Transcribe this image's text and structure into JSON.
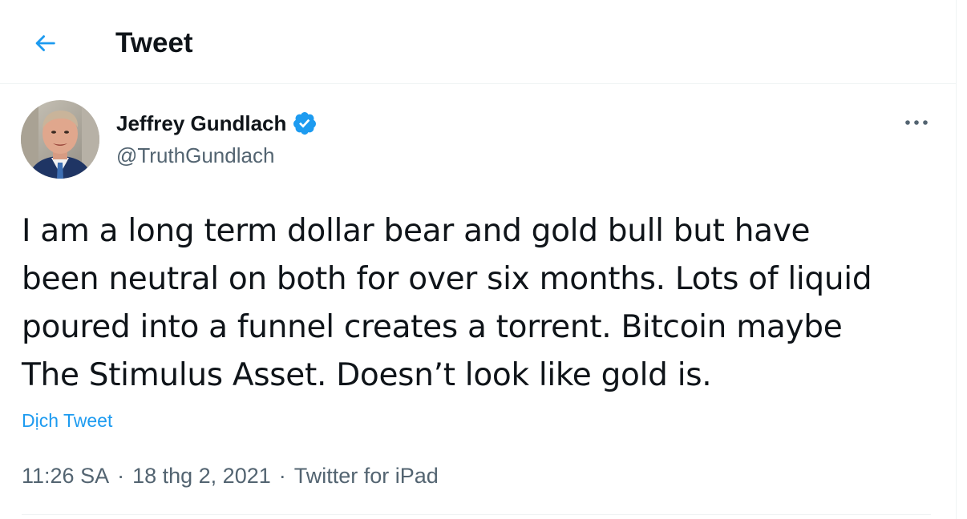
{
  "header": {
    "back_icon": "arrow-left-icon",
    "title": "Tweet"
  },
  "tweet": {
    "author": {
      "name": "Jeffrey Gundlach",
      "handle": "@TruthGundlach",
      "verified": true,
      "verified_icon": "verified-badge-icon"
    },
    "more_icon": "more-horizontal-icon",
    "text": "I am a long term dollar bear and gold bull but have\nbeen neutral on both for over six months. Lots of liquid\npoured into a funnel creates a torrent. Bitcoin maybe\nThe Stimulus Asset. Doesn’t look like gold is.",
    "translate_label": "Dịch Tweet",
    "time": "11:26 SA",
    "date": "18 thg 2, 2021",
    "separator": "·",
    "source": "Twitter for iPad"
  },
  "colors": {
    "accent": "#1d9bf0",
    "text_primary": "#0f1419",
    "text_secondary": "#536471",
    "border": "#eff3f4"
  }
}
